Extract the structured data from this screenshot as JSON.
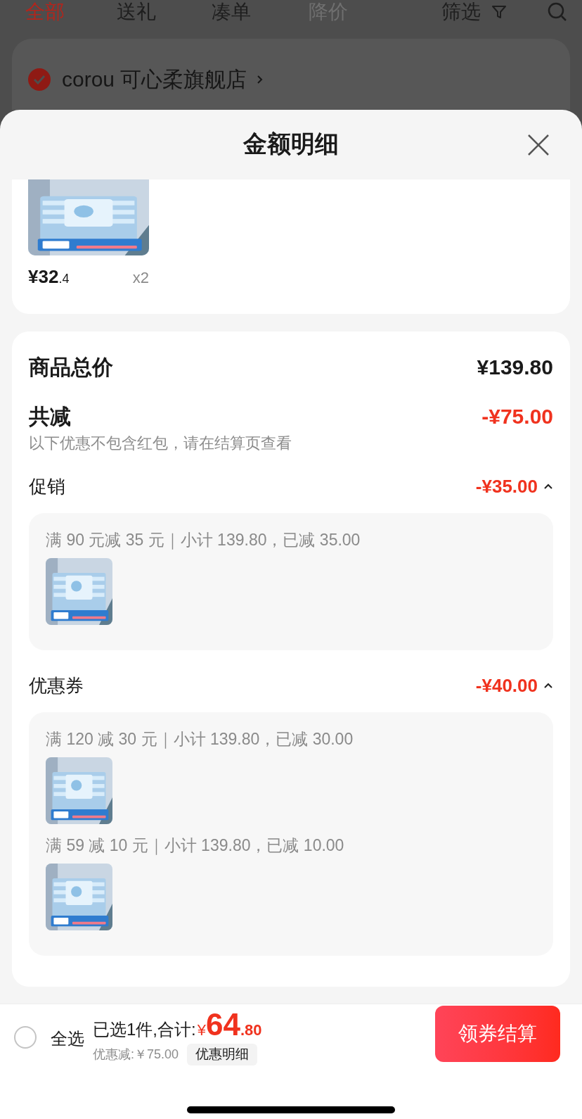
{
  "top_tabs": [
    {
      "label": "全部",
      "selected": true,
      "disabled": false
    },
    {
      "label": "送礼",
      "selected": false,
      "disabled": false
    },
    {
      "label": "凑单",
      "selected": false,
      "disabled": false
    },
    {
      "label": "降价",
      "selected": false,
      "disabled": true
    }
  ],
  "filter": {
    "label": "筛选"
  },
  "store": {
    "name": "corou 可心柔旗舰店",
    "checked": true
  },
  "sheet": {
    "title": "金额明细",
    "product": {
      "price_main": "¥32",
      "price_decimal": ".4",
      "quantity": "x2"
    },
    "summary": {
      "total_label": "商品总价",
      "total": "¥139.80",
      "reduction_label": "共减",
      "reduction": "-¥75.00",
      "note": "以下优惠不包含红包，请在结算页查看",
      "groups": [
        {
          "label": "促销",
          "amount": "-¥35.00",
          "expanded": true,
          "rules": [
            {
              "text": "满 90 元减 35 元｜小计 139.80，已减 35.00"
            }
          ]
        },
        {
          "label": "优惠券",
          "amount": "-¥40.00",
          "expanded": true,
          "rules": [
            {
              "text": "满 120 减 30 元｜小计 139.80，已减 30.00"
            },
            {
              "text": "满 59 减 10 元｜小计 139.80，已减 10.00"
            }
          ]
        }
      ]
    }
  },
  "bottom_bar": {
    "select_all": {
      "label": "全选",
      "checked": false
    },
    "selected_text": "已选1件,合计:",
    "currency": "¥",
    "total_main": "64",
    "total_decimal": ".80",
    "discount": "优惠减:￥75.00",
    "detail_button": "优惠明细",
    "checkout_button": "领券结算"
  }
}
